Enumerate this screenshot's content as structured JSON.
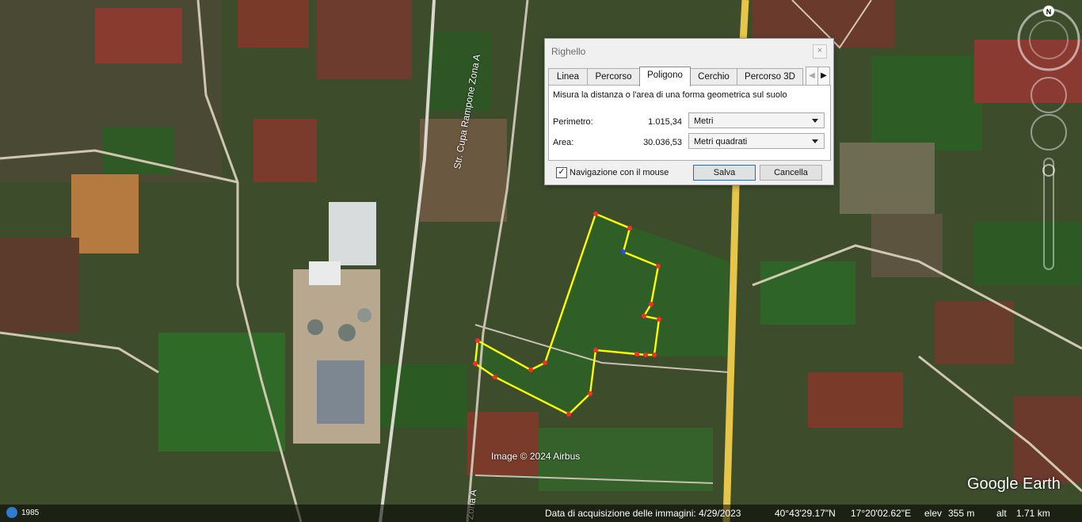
{
  "dialog": {
    "title": "Righello",
    "close_glyph": "×",
    "tabs": [
      {
        "label": "Linea",
        "active": false
      },
      {
        "label": "Percorso",
        "active": false
      },
      {
        "label": "Poligono",
        "active": true
      },
      {
        "label": "Cerchio",
        "active": false
      },
      {
        "label": "Percorso 3D",
        "active": false
      }
    ],
    "tab_prev_glyph": "◀",
    "tab_next_glyph": "▶",
    "description": "Misura la distanza o l'area di una forma geometrica sul suolo",
    "perimeter": {
      "label": "Perimetro:",
      "value": "1.015,34",
      "unit": "Metri"
    },
    "area": {
      "label": "Area:",
      "value": "30.036,53",
      "unit": "Metri quadrati"
    },
    "mouse_nav": {
      "label": "Navigazione con il mouse",
      "checked": true,
      "check_glyph": "✓"
    },
    "save_label": "Salva",
    "cancel_label": "Cancella"
  },
  "map": {
    "road_label_main": "Str. Cupa Rampone Zona A",
    "road_label_bottom": "Zona A",
    "credit": "Image © 2024 Airbus",
    "logo": "Google Earth",
    "compass_letter": "N",
    "polygon_color": "#ffff00",
    "vertex_color": "#ff2a2a",
    "road_color": "#e6c64a"
  },
  "status": {
    "year": "1985",
    "acquisition": "Data di acquisizione delle immagini: 4/29/2023",
    "lat": "40°43'29.17\"N",
    "lon": "17°20'02.62\"E",
    "elev_label": "elev",
    "elev": "355 m",
    "alt_label": "alt",
    "alt": "1.71 km"
  }
}
